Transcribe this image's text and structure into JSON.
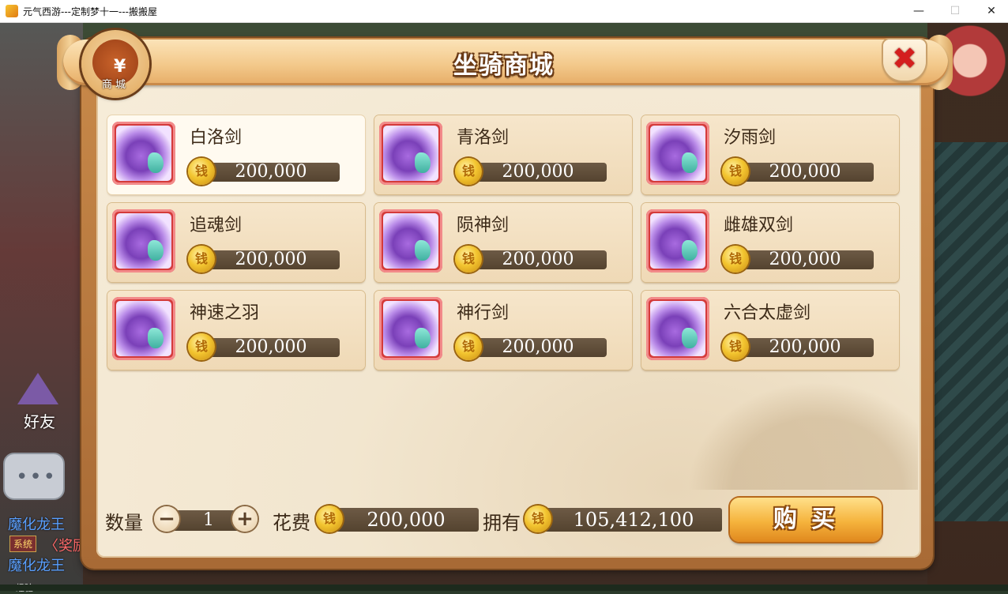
{
  "window": {
    "title": "元气西游---定制梦十一---搬搬屋",
    "minimize_glyph": "—",
    "maximize_glyph": "☐",
    "close_glyph": "✕"
  },
  "background": {
    "friend_label": "好友",
    "chat_dots": "•••",
    "chat_lines": [
      "魔化龙王",
      "魔化龙王"
    ],
    "system_tag": "系统",
    "system_text": "〈奖励",
    "exp_text": "经验"
  },
  "panel": {
    "title": "坐骑商城",
    "badge_label": "商城",
    "badge_icon": "money-bag-icon",
    "close_label": "✖"
  },
  "items": [
    {
      "name": "白洛剑",
      "price": "200,000",
      "selected": true
    },
    {
      "name": "青洛剑",
      "price": "200,000"
    },
    {
      "name": "汐雨剑",
      "price": "200,000"
    },
    {
      "name": "追魂剑",
      "price": "200,000"
    },
    {
      "name": "陨神剑",
      "price": "200,000"
    },
    {
      "name": "雌雄双剑",
      "price": "200,000"
    },
    {
      "name": "神速之羽",
      "price": "200,000"
    },
    {
      "name": "神行剑",
      "price": "200,000"
    },
    {
      "name": "六合太虚剑",
      "price": "200,000"
    }
  ],
  "footer": {
    "qty_label": "数量",
    "qty_value": "1",
    "minus": "−",
    "plus": "+",
    "cost_label": "花费",
    "cost_value": "200,000",
    "own_label": "拥有",
    "own_value": "105,412,100",
    "buy_label": "购买"
  },
  "colors": {
    "accent": "#f5b33c",
    "close_red": "#d41e1e",
    "price_bar": "#5e4b37"
  }
}
